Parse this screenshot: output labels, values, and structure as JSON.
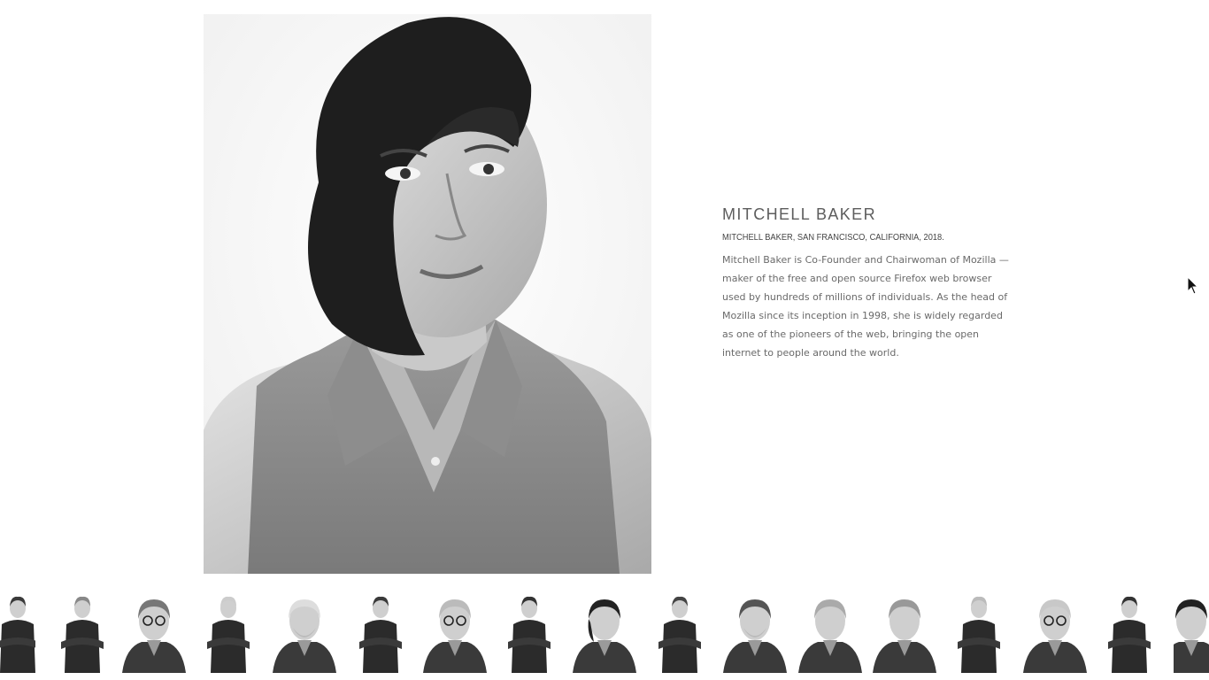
{
  "profile": {
    "name": "MITCHELL BAKER",
    "caption": "MITCHELL BAKER, SAN FRANCISCO, CALIFORNIA, 2018.",
    "bio": "Mitchell Baker is Co-Founder and Chairwoman of Mozilla — maker of the free and open source Firefox web browser used by hundreds of millions of individuals. As the head of Mozilla since its inception in 1998, she is widely regarded as one of the pioneers of the web, bringing the open internet to people around the world."
  },
  "colors": {
    "background": "#ffffff",
    "name_text": "#5d5d5d",
    "body_text": "#6a6a6a"
  },
  "thumbnails": [
    {
      "id": "portrait-thumb-1",
      "pose": "arms-crossed",
      "hair": "#3a3a3a"
    },
    {
      "id": "portrait-thumb-2",
      "pose": "scarf",
      "hair": "#888"
    },
    {
      "id": "portrait-thumb-3",
      "pose": "glasses-bust",
      "hair": "#777"
    },
    {
      "id": "portrait-thumb-4",
      "pose": "full-suit",
      "hair": "#ccc"
    },
    {
      "id": "portrait-thumb-5",
      "pose": "beard-suit",
      "hair": "#ddd"
    },
    {
      "id": "portrait-thumb-6",
      "pose": "arms-crossed",
      "hair": "#3a3a3a"
    },
    {
      "id": "portrait-thumb-7",
      "pose": "glasses-bust",
      "hair": "#bbb"
    },
    {
      "id": "portrait-thumb-8",
      "pose": "standing",
      "hair": "#333"
    },
    {
      "id": "portrait-thumb-9",
      "pose": "bob",
      "hair": "#222"
    },
    {
      "id": "portrait-thumb-10",
      "pose": "standing-hands-hips",
      "hair": "#444"
    },
    {
      "id": "portrait-thumb-11",
      "pose": "long-hair-smile",
      "hair": "#555"
    },
    {
      "id": "portrait-thumb-12",
      "pose": "hand-face",
      "hair": "#aaa"
    },
    {
      "id": "portrait-thumb-13",
      "pose": "bust",
      "hair": "#999"
    },
    {
      "id": "portrait-thumb-14",
      "pose": "hands-together",
      "hair": "#bbb"
    },
    {
      "id": "portrait-thumb-15",
      "pose": "glasses-bust",
      "hair": "#c8c8c8"
    },
    {
      "id": "portrait-thumb-16",
      "pose": "holding-cup",
      "hair": "#333"
    },
    {
      "id": "portrait-thumb-17",
      "pose": "bust",
      "hair": "#222"
    }
  ]
}
